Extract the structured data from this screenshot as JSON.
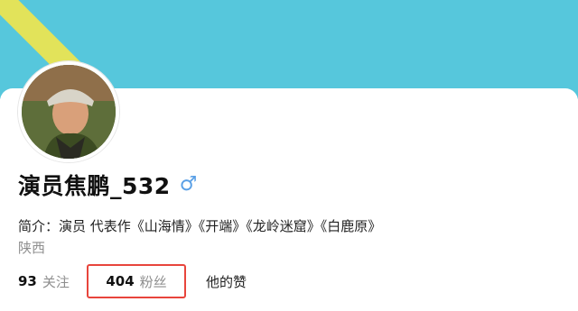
{
  "profile": {
    "name": "演员焦鹏_532",
    "gender_symbol": "♂",
    "bio": "简介：演员   代表作《山海情》《开端》《龙岭迷窟》《白鹿原》",
    "location": "陕西"
  },
  "stats": {
    "following_count": "93",
    "following_label": "关注",
    "followers_count": "404",
    "followers_label": "粉丝",
    "likes_label": "他的赞"
  },
  "colors": {
    "banner": "#56c7dc",
    "banner_stripe": "#e2e35a",
    "gender_icon": "#5aa0e6",
    "highlight_box": "#e8453c"
  },
  "icons": {
    "gender": "male-icon"
  }
}
